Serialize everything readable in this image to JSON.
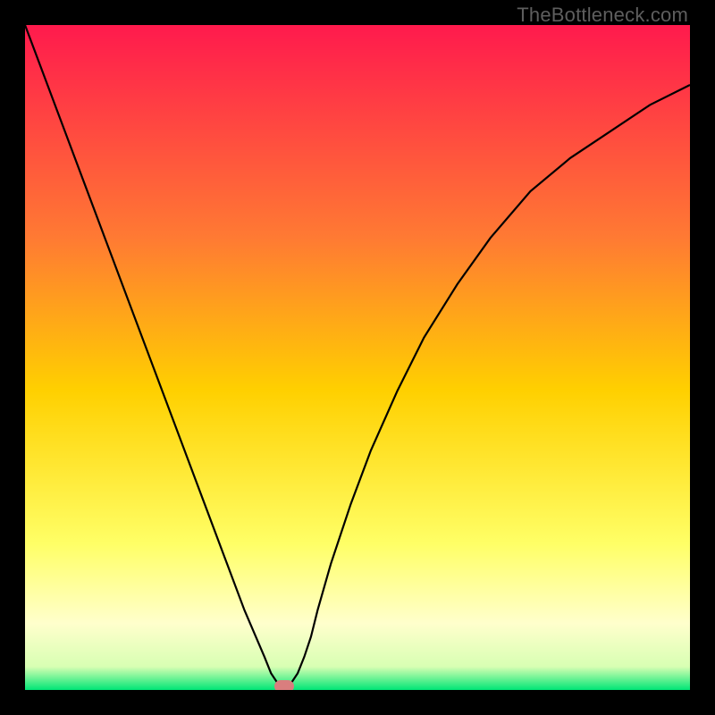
{
  "watermark": "TheBottleneck.com",
  "colors": {
    "top": "#ff1a4d",
    "mid_upper": "#ff7a33",
    "mid": "#ffd000",
    "mid_lower": "#ffff66",
    "pale": "#ffffcc",
    "bottom": "#00e676",
    "curve": "#000000",
    "marker": "#d97e7e",
    "frame": "#000000"
  },
  "chart_data": {
    "type": "line",
    "title": "",
    "xlabel": "",
    "ylabel": "",
    "xlim": [
      0,
      100
    ],
    "ylim": [
      0,
      100
    ],
    "x": [
      0,
      3,
      6,
      9,
      12,
      15,
      18,
      21,
      24,
      27,
      30,
      33,
      36,
      37,
      38,
      38.5,
      39,
      39.5,
      40,
      41,
      42,
      43,
      44,
      46,
      49,
      52,
      56,
      60,
      65,
      70,
      76,
      82,
      88,
      94,
      100
    ],
    "values": [
      100,
      92,
      84,
      76,
      68,
      60,
      52,
      44,
      36,
      28,
      20,
      12,
      5,
      2.5,
      1,
      0.6,
      0.6,
      0.6,
      1,
      2.5,
      5,
      8,
      12,
      19,
      28,
      36,
      45,
      53,
      61,
      68,
      75,
      80,
      84,
      88,
      91
    ],
    "optimum_x": 39,
    "optimum_y": 0.6,
    "gradient_stops": [
      {
        "pos": 0.0,
        "color": "#ff1a4d"
      },
      {
        "pos": 0.32,
        "color": "#ff7a33"
      },
      {
        "pos": 0.55,
        "color": "#ffd000"
      },
      {
        "pos": 0.78,
        "color": "#ffff66"
      },
      {
        "pos": 0.9,
        "color": "#ffffcc"
      },
      {
        "pos": 0.965,
        "color": "#d8ffb3"
      },
      {
        "pos": 1.0,
        "color": "#00e676"
      }
    ]
  }
}
